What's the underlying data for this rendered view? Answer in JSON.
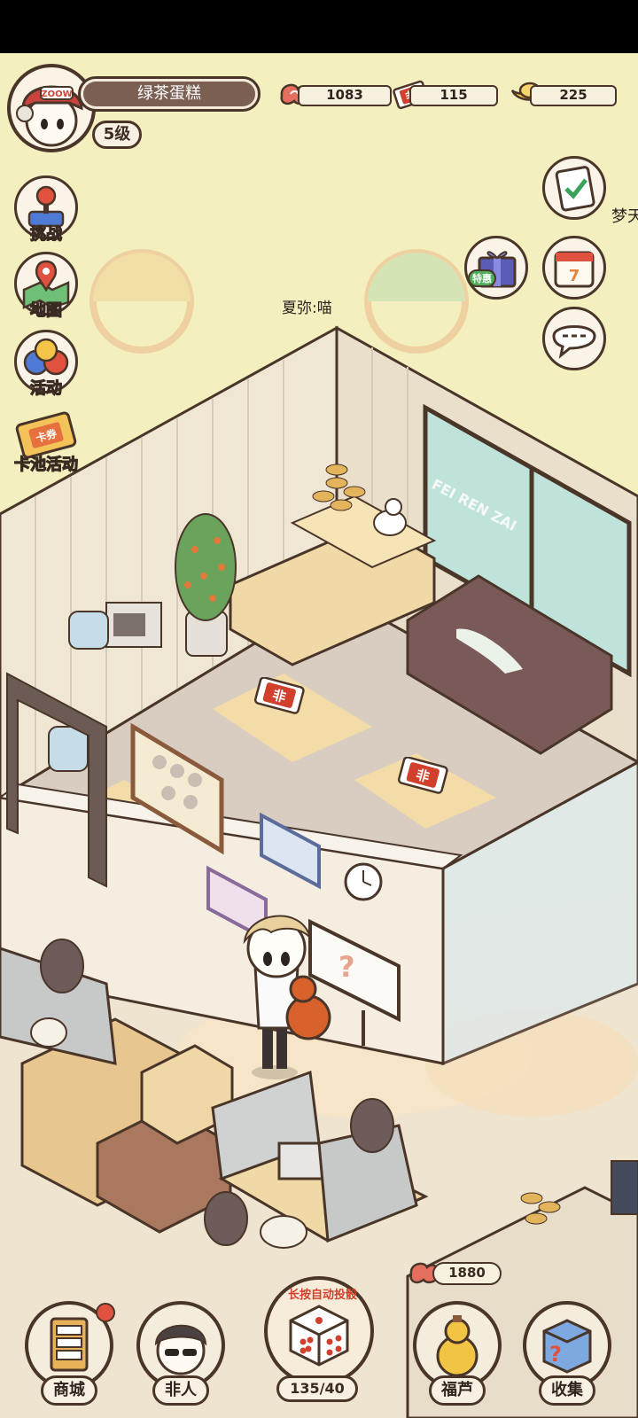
{
  "player": {
    "name": "绿茶蛋糕",
    "level": "5级",
    "cap_text": "ZOOW"
  },
  "resources": {
    "coins": "1083",
    "tickets": "115",
    "gold": "225",
    "ticket_symbol": "非"
  },
  "side_menu": [
    {
      "label": "挑战",
      "icon": "joystick-icon"
    },
    {
      "label": "地图",
      "icon": "map-pin-icon"
    },
    {
      "label": "活动",
      "icon": "balloons-icon"
    },
    {
      "label": "卡池活动",
      "icon": "card-ticket-icon",
      "badge": "卡券"
    }
  ],
  "right_menu": {
    "tasks_icon": "clipboard-check-icon",
    "truncated_label": "梦天",
    "gift_badge": "特惠",
    "calendar_day": "7",
    "chat_icon": "chat-bubble-icon"
  },
  "scene": {
    "speech": "夏弥:喵",
    "window_text": "FEI REN ZAI",
    "pickup_symbol": "非",
    "floor_coin_value": "1880",
    "whiteboard_mark": "?"
  },
  "bottom_bar": {
    "shop": "商城",
    "feiren": "非人",
    "dice_hint": "长按自动投骰",
    "dice_counter": "135/40",
    "fulu": "福芦",
    "collect": "收集"
  },
  "colors": {
    "background": "#f3efbf",
    "outline": "#4a3529",
    "accent_red": "#d0402d",
    "wall": "#f0e7d6"
  }
}
